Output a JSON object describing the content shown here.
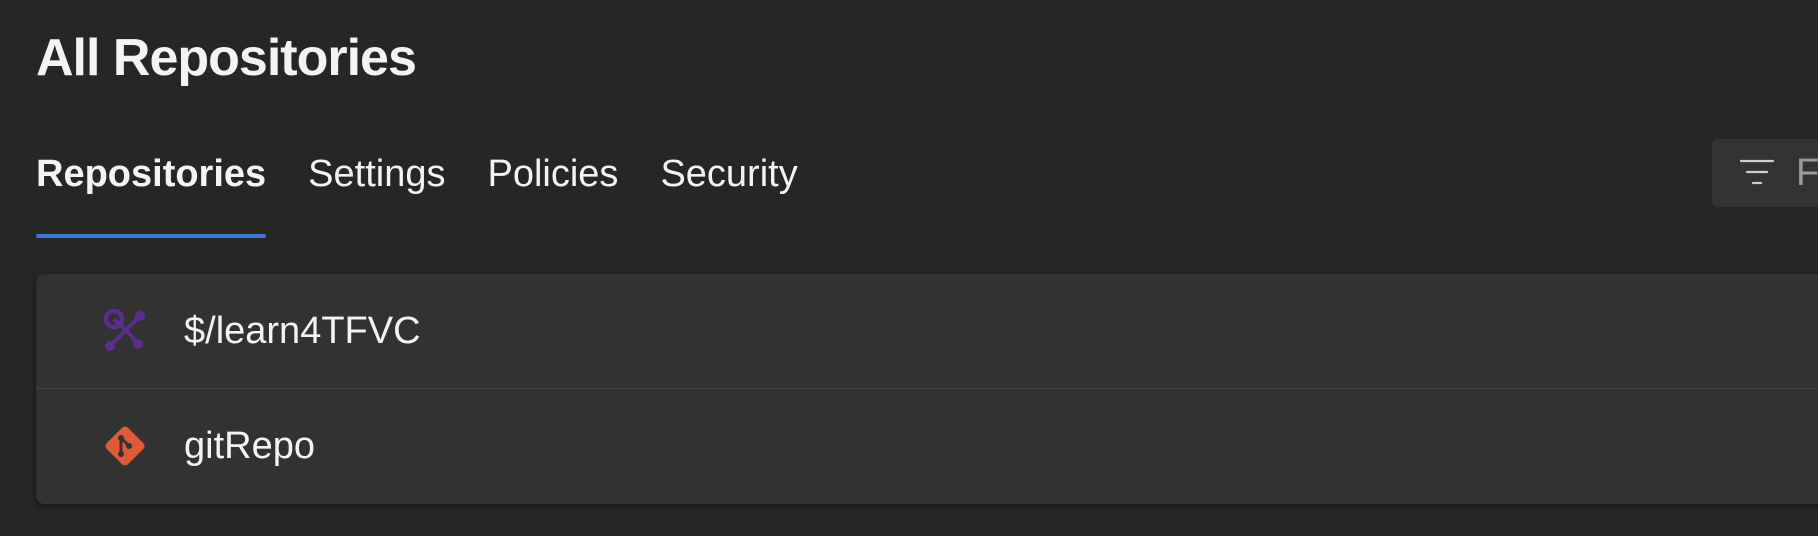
{
  "header": {
    "title": "All Repositories"
  },
  "tabs": [
    {
      "label": "Repositories",
      "active": true
    },
    {
      "label": "Settings",
      "active": false
    },
    {
      "label": "Policies",
      "active": false
    },
    {
      "label": "Security",
      "active": false
    }
  ],
  "filter": {
    "icon": "filter-icon",
    "visible_text": "F"
  },
  "repositories": [
    {
      "name": "$/learn4TFVC",
      "icon": "tfvc-repo-icon",
      "icon_color": "#5c2d91"
    },
    {
      "name": "gitRepo",
      "icon": "git-repo-icon",
      "icon_color": "#e05a3a"
    }
  ],
  "colors": {
    "background": "#262626",
    "accent": "#3b78d0",
    "card": "#323232"
  }
}
